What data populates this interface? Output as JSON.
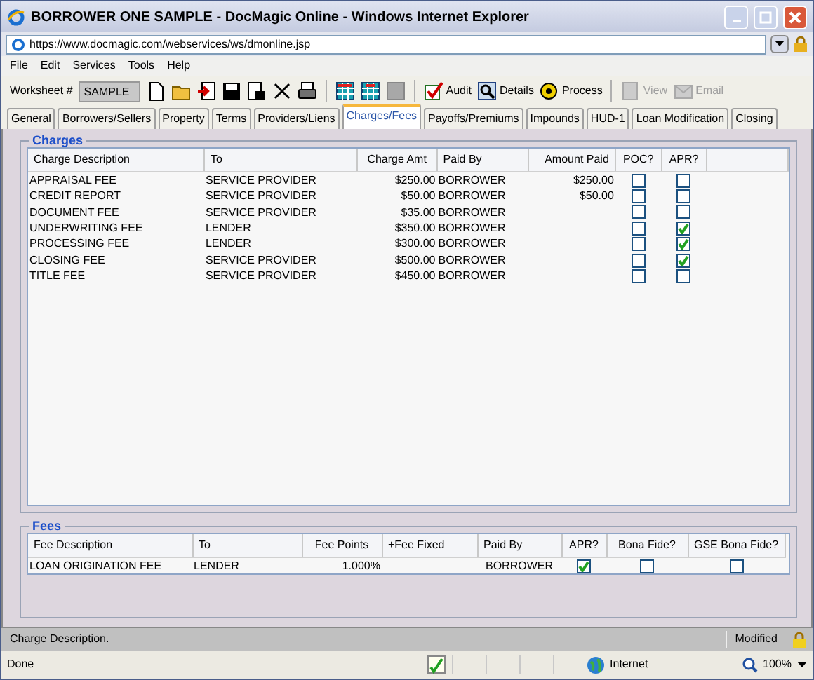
{
  "window": {
    "title": "BORROWER ONE SAMPLE - DocMagic Online - Windows Internet Explorer"
  },
  "address_bar": {
    "url": "https://www.docmagic.com/webservices/ws/dmonline.jsp"
  },
  "menu": [
    "File",
    "Edit",
    "Services",
    "Tools",
    "Help"
  ],
  "toolbar": {
    "worksheet_label": "Worksheet #",
    "worksheet_value": "SAMPLE",
    "buttons": [
      {
        "label": "Audit",
        "disabled": false
      },
      {
        "label": "Details",
        "disabled": false
      },
      {
        "label": "Process",
        "disabled": false
      },
      {
        "label": "View",
        "disabled": true
      },
      {
        "label": "Email",
        "disabled": true
      }
    ]
  },
  "tabs": [
    {
      "label": "General",
      "selected": false
    },
    {
      "label": "Borrowers/Sellers",
      "selected": false
    },
    {
      "label": "Property",
      "selected": false
    },
    {
      "label": "Terms",
      "selected": false
    },
    {
      "label": "Providers/Liens",
      "selected": false
    },
    {
      "label": "Charges/Fees",
      "selected": true
    },
    {
      "label": "Payoffs/Premiums",
      "selected": false
    },
    {
      "label": "Impounds",
      "selected": false
    },
    {
      "label": "HUD-1",
      "selected": false
    },
    {
      "label": "Loan Modification",
      "selected": false
    },
    {
      "label": "Closing",
      "selected": false
    }
  ],
  "charges": {
    "title": "Charges",
    "columns": [
      "Charge Description",
      "To",
      "Charge Amt",
      "Paid By",
      "Amount Paid",
      "POC?",
      "APR?"
    ],
    "rows": [
      {
        "description": "APPRAISAL FEE",
        "to": "SERVICE PROVIDER",
        "amount": "$250.00",
        "paid_by": "BORROWER",
        "amount_paid": "$250.00",
        "poc": false,
        "apr": false
      },
      {
        "description": "CREDIT REPORT",
        "to": "SERVICE PROVIDER",
        "amount": "$50.00",
        "paid_by": "BORROWER",
        "amount_paid": "$50.00",
        "poc": false,
        "apr": false
      },
      {
        "description": "DOCUMENT FEE",
        "to": "SERVICE PROVIDER",
        "amount": "$35.00",
        "paid_by": "BORROWER",
        "poc": false,
        "apr": false
      },
      {
        "description": "UNDERWRITING FEE",
        "to": "LENDER",
        "amount": "$350.00",
        "paid_by": "BORROWER",
        "poc": false,
        "apr": true
      },
      {
        "description": "PROCESSING FEE",
        "to": "LENDER",
        "amount": "$300.00",
        "paid_by": "BORROWER",
        "poc": false,
        "apr": true
      },
      {
        "description": "CLOSING FEE",
        "to": "SERVICE PROVIDER",
        "amount": "$500.00",
        "paid_by": "BORROWER",
        "poc": false,
        "apr": true
      },
      {
        "description": "TITLE FEE",
        "to": "SERVICE PROVIDER",
        "amount": "$450.00",
        "paid_by": "BORROWER",
        "poc": false,
        "apr": false
      }
    ]
  },
  "fees": {
    "title": "Fees",
    "columns": [
      "Fee Description",
      "To",
      "Fee Points",
      "+Fee Fixed",
      "Paid By",
      "APR?",
      "Bona Fide?",
      "GSE Bona Fide?"
    ],
    "rows": [
      {
        "description": "LOAN ORIGINATION FEE",
        "to": "LENDER",
        "fee_points": "1.000%",
        "paid_by": "BORROWER",
        "apr": true,
        "bona_fide": false,
        "gse_bona_fide": false
      }
    ]
  },
  "app_status": {
    "message": "Charge Description.",
    "state": "Modified"
  },
  "browser_status": {
    "text": "Done",
    "zone": "Internet",
    "zoom": "100%"
  }
}
